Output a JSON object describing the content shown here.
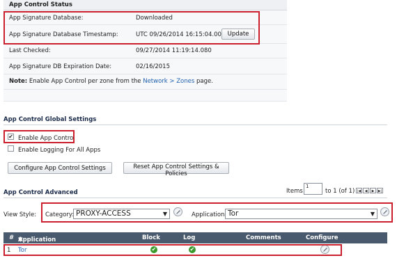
{
  "status": {
    "title": "App Control Status",
    "rows": [
      {
        "label": "App Signature Database:",
        "value": "Downloaded"
      },
      {
        "label": "App Signature Database Timestamp:",
        "value": "UTC 09/26/2014 16:15:04.000"
      },
      {
        "label": "Last Checked:",
        "value": "09/27/2014 11:19:14.080"
      },
      {
        "label": "App Signature DB Expiration Date:",
        "value": "02/16/2015"
      }
    ],
    "update_label": "Update",
    "note_bold": "Note:",
    "note_text": "Enable App Control per zone from the",
    "note_link": "Network > Zones",
    "note_tail": "page."
  },
  "global": {
    "title": "App Control Global Settings",
    "enable_label": "Enable App Control",
    "enable_checked": true,
    "logging_label": "Enable Logging For All Apps",
    "logging_checked": false,
    "configure_button": "Configure App Control Settings",
    "reset_button": "Reset App Control Settings & Policies"
  },
  "advanced": {
    "title": "App Control Advanced",
    "items_label": "Items",
    "items_value": "1",
    "items_range": "to 1 (of 1)",
    "view_style_label": "View Style:",
    "category_label": "Category:",
    "category_value": "PROXY-ACCESS",
    "application_label": "Application:",
    "application_value": "Tor"
  },
  "table": {
    "headers": {
      "num": "#",
      "application": "Application",
      "block": "Block",
      "log": "Log",
      "comments": "Comments",
      "configure": "Configure"
    },
    "rows": [
      {
        "num": "1",
        "application": "Tor",
        "block": true,
        "log": true,
        "comments": ""
      }
    ]
  },
  "colors": {
    "highlight": "#cc1f2e",
    "header_bg": "#4a5a6e",
    "ok": "#3b9a2c",
    "link": "#1f5fae"
  }
}
